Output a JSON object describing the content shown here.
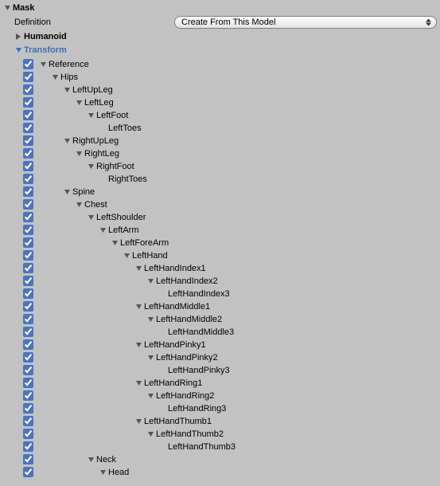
{
  "mask_label": "Mask",
  "definition_label": "Definition",
  "definition_value": "Create From This Model",
  "humanoid_label": "Humanoid",
  "transform_label": "Transform",
  "tree": [
    {
      "label": "Reference",
      "indent": 0,
      "foldout": true
    },
    {
      "label": "Hips",
      "indent": 1,
      "foldout": true
    },
    {
      "label": "LeftUpLeg",
      "indent": 2,
      "foldout": true
    },
    {
      "label": "LeftLeg",
      "indent": 3,
      "foldout": true
    },
    {
      "label": "LeftFoot",
      "indent": 4,
      "foldout": true
    },
    {
      "label": "LeftToes",
      "indent": 5,
      "foldout": false
    },
    {
      "label": "RightUpLeg",
      "indent": 2,
      "foldout": true
    },
    {
      "label": "RightLeg",
      "indent": 3,
      "foldout": true
    },
    {
      "label": "RightFoot",
      "indent": 4,
      "foldout": true
    },
    {
      "label": "RightToes",
      "indent": 5,
      "foldout": false
    },
    {
      "label": "Spine",
      "indent": 2,
      "foldout": true
    },
    {
      "label": "Chest",
      "indent": 3,
      "foldout": true
    },
    {
      "label": "LeftShoulder",
      "indent": 4,
      "foldout": true
    },
    {
      "label": "LeftArm",
      "indent": 5,
      "foldout": true
    },
    {
      "label": "LeftForeArm",
      "indent": 6,
      "foldout": true
    },
    {
      "label": "LeftHand",
      "indent": 7,
      "foldout": true
    },
    {
      "label": "LeftHandIndex1",
      "indent": 8,
      "foldout": true
    },
    {
      "label": "LeftHandIndex2",
      "indent": 9,
      "foldout": true
    },
    {
      "label": "LeftHandIndex3",
      "indent": 10,
      "foldout": false
    },
    {
      "label": "LeftHandMiddle1",
      "indent": 8,
      "foldout": true
    },
    {
      "label": "LeftHandMiddle2",
      "indent": 9,
      "foldout": true
    },
    {
      "label": "LeftHandMiddle3",
      "indent": 10,
      "foldout": false
    },
    {
      "label": "LeftHandPinky1",
      "indent": 8,
      "foldout": true
    },
    {
      "label": "LeftHandPinky2",
      "indent": 9,
      "foldout": true
    },
    {
      "label": "LeftHandPinky3",
      "indent": 10,
      "foldout": false
    },
    {
      "label": "LeftHandRing1",
      "indent": 8,
      "foldout": true
    },
    {
      "label": "LeftHandRing2",
      "indent": 9,
      "foldout": true
    },
    {
      "label": "LeftHandRing3",
      "indent": 10,
      "foldout": false
    },
    {
      "label": "LeftHandThumb1",
      "indent": 8,
      "foldout": true
    },
    {
      "label": "LeftHandThumb2",
      "indent": 9,
      "foldout": true
    },
    {
      "label": "LeftHandThumb3",
      "indent": 10,
      "foldout": false
    },
    {
      "label": "Neck",
      "indent": 4,
      "foldout": true
    },
    {
      "label": "Head",
      "indent": 5,
      "foldout": true
    }
  ]
}
